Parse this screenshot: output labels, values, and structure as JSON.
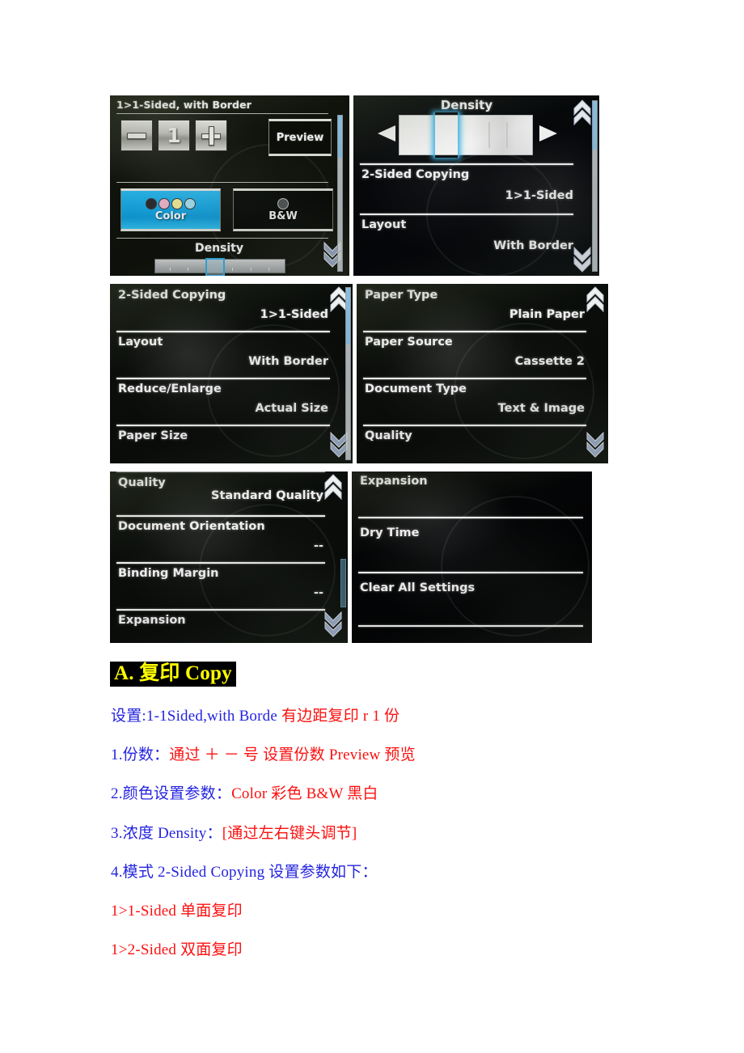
{
  "document": {
    "heading": {
      "prefix": "A. ",
      "cn": "复印",
      "en": " Copy"
    },
    "lines": [
      {
        "id": "line-setting",
        "segments": [
          {
            "t": "设置:1-1Sided,with Borde ",
            "c": "blue"
          },
          {
            "t": "有边距复印 r 1 份",
            "c": "red"
          }
        ]
      },
      {
        "id": "line-copies",
        "segments": [
          {
            "t": "1.份数：",
            "c": "blue"
          },
          {
            "t": "通过 ＋ － 号 设置份数   Preview 预览",
            "c": "red"
          }
        ]
      },
      {
        "id": "line-color",
        "segments": [
          {
            "t": "2.颜色设置参数：",
            "c": "blue"
          },
          {
            "t": "Color 彩色     B&W 黑白",
            "c": "red"
          }
        ]
      },
      {
        "id": "line-density",
        "segments": [
          {
            "t": "3.浓度 Density：",
            "c": "blue"
          },
          {
            "t": "[通过左右键头调节]",
            "c": "red"
          }
        ]
      },
      {
        "id": "line-mode",
        "segments": [
          {
            "t": "4.模式 2-Sided Copying 设置参数如下：",
            "c": "blue"
          }
        ]
      },
      {
        "id": "line-1to1",
        "segments": [
          {
            "t": "1>1-Sided  单面复印",
            "c": "red"
          }
        ]
      },
      {
        "id": "line-1to2",
        "segments": [
          {
            "t": "1>2-Sided 双面复印",
            "c": "red"
          }
        ]
      }
    ]
  },
  "colors": {
    "heading_text": "#ffff00",
    "heading_bg": "#000000",
    "blue": "#2424e0",
    "red": "#fc1010",
    "lcd_accent": "#2fb4ee",
    "color_button_bg": "#16a9e6"
  },
  "screens": {
    "panel1": {
      "title": "1>1-Sided, with Border",
      "copies_value": "1",
      "minus_label": "−",
      "plus_label": "+",
      "preview_label": "Preview",
      "color_label": "Color",
      "bw_label": "B&W",
      "density_label": "Density",
      "ink_dots": [
        "black",
        "magenta",
        "yellow",
        "cyan"
      ]
    },
    "panel2": {
      "density_label": "Density",
      "rows": [
        {
          "key": "2-Sided Copying",
          "value": "1>1-Sided"
        },
        {
          "key": "Layout",
          "value": "With Border"
        }
      ]
    },
    "panel3": {
      "rows": [
        {
          "key": "2-Sided Copying",
          "value": "1>1-Sided"
        },
        {
          "key": "Layout",
          "value": "With Border"
        },
        {
          "key": "Reduce/Enlarge",
          "value": "Actual Size"
        },
        {
          "key": "Paper Size",
          "value": ""
        }
      ]
    },
    "panel4": {
      "rows": [
        {
          "key": "Paper Type",
          "value": "Plain Paper"
        },
        {
          "key": "Paper Source",
          "value": "Cassette 2"
        },
        {
          "key": "Document Type",
          "value": "Text & Image"
        },
        {
          "key": "Quality",
          "value": ""
        }
      ]
    },
    "panel5": {
      "rows": [
        {
          "key": "Quality",
          "value": "Standard Quality"
        },
        {
          "key": "Document Orientation",
          "value": "--"
        },
        {
          "key": "Binding Margin",
          "value": "--"
        },
        {
          "key": "Expansion",
          "value": ""
        }
      ]
    },
    "panel6": {
      "rows": [
        {
          "key": "Expansion",
          "value": ""
        },
        {
          "key": "Dry Time",
          "value": ""
        },
        {
          "key": "Clear All Settings",
          "value": ""
        }
      ]
    }
  }
}
